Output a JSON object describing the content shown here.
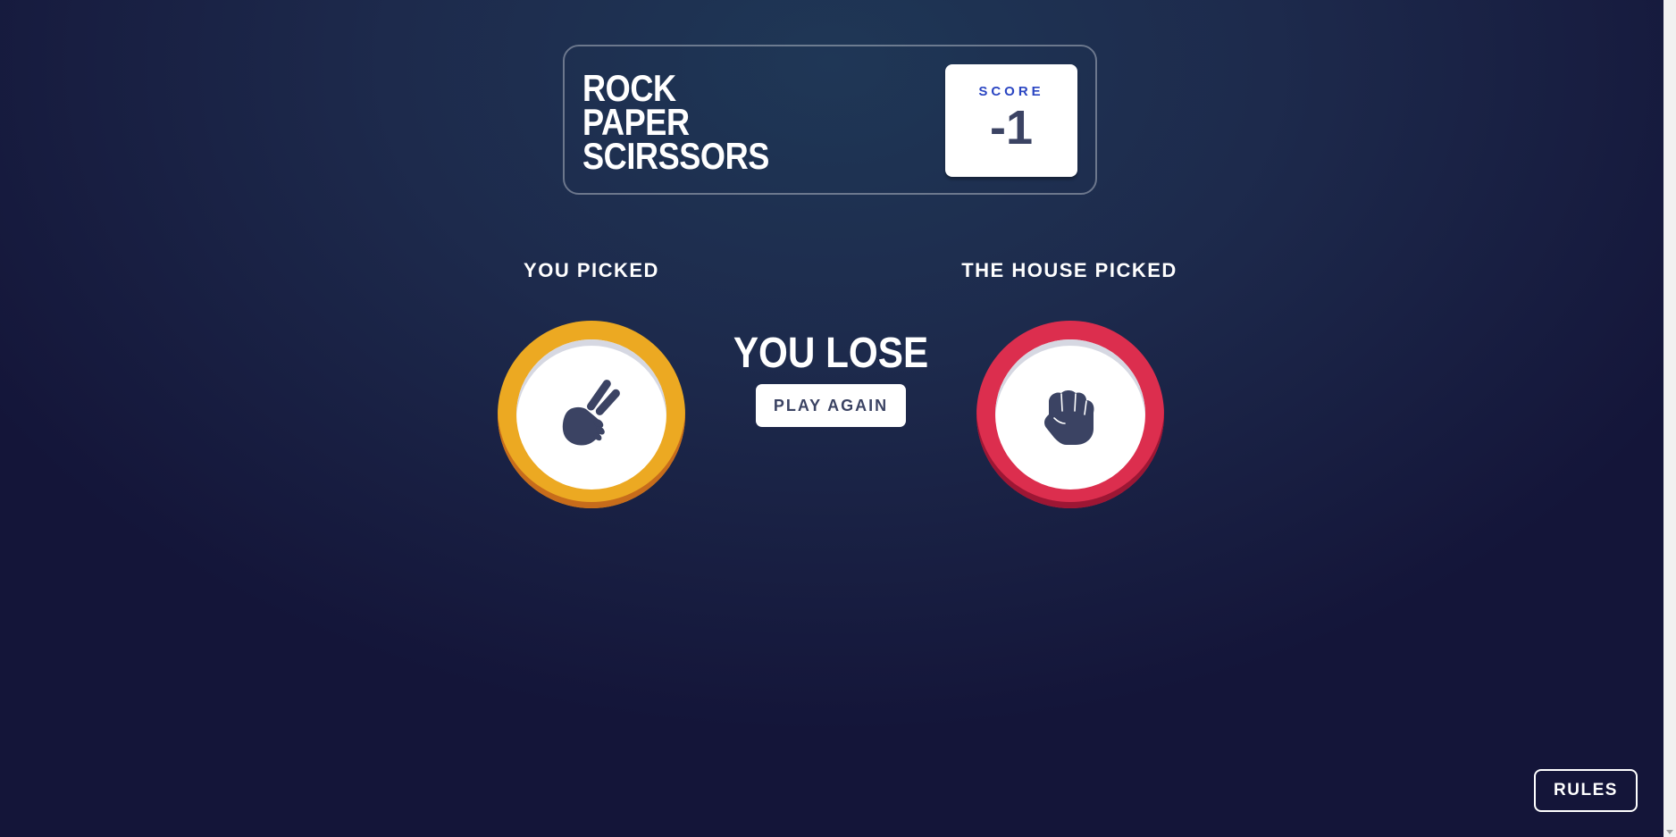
{
  "header": {
    "title_lines": [
      "ROCK",
      "PAPER",
      "SCIRSSORS"
    ],
    "score_label": "SCORE",
    "score_value": "-1"
  },
  "game": {
    "you_picked_label": "YOU PICKED",
    "house_picked_label": "THE HOUSE PICKED",
    "player_choice": "scissors",
    "house_choice": "rock",
    "result_text": "YOU LOSE",
    "play_again_label": "PLAY AGAIN"
  },
  "rules_button_label": "RULES",
  "colors": {
    "scissors": "#eca922",
    "rock": "#dc2e4e",
    "score_label": "#2a45c2",
    "dark_text": "#3b4363"
  },
  "icons": {
    "player": "scissors-hand-icon",
    "house": "rock-fist-icon"
  }
}
